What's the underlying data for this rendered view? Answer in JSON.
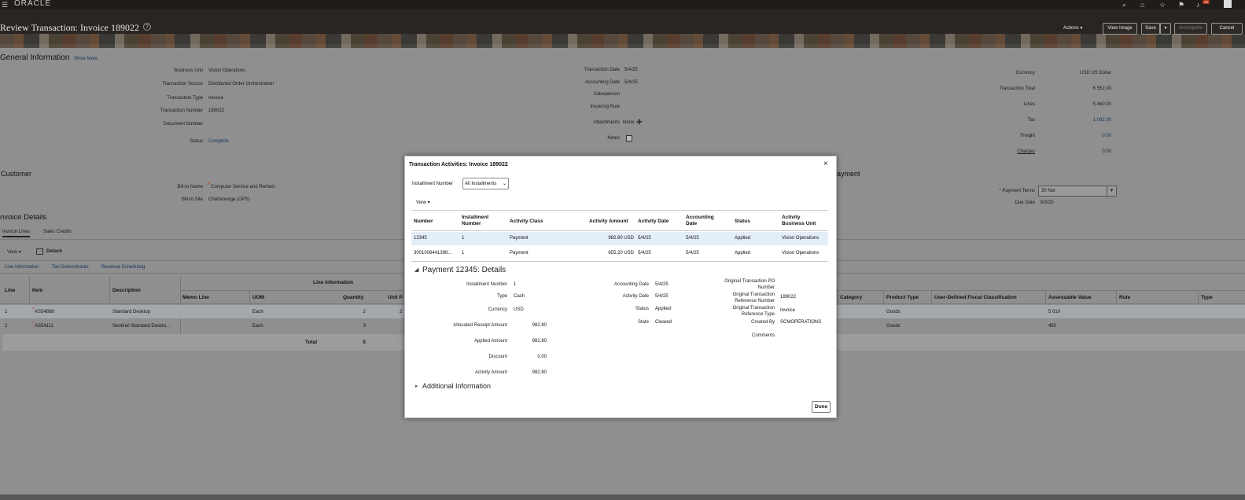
{
  "header": {
    "logo": "ORACLE",
    "title": "Review Transaction: Invoice 189022",
    "actions": "Actions",
    "view_image": "View Image",
    "save": "Save",
    "incomplete": "Incomplete",
    "cancel": "Cancel",
    "notif_count": "99"
  },
  "general": {
    "heading": "General Information",
    "show_more": "Show More",
    "left": [
      {
        "l": "Business Unit",
        "v": "Vision Operations"
      },
      {
        "l": "Transaction Source",
        "v": "Distributed Order Orchestration"
      },
      {
        "l": "Transaction Type",
        "v": "Invoice"
      },
      {
        "l": "Transaction Number",
        "v": "189022"
      },
      {
        "l": "Document Number",
        "v": ""
      },
      {
        "l": "Status",
        "v": "Complete"
      }
    ],
    "mid": [
      {
        "l": "Transaction Date",
        "v": "5/4/25"
      },
      {
        "l": "Accounting Date",
        "v": "5/4/25"
      },
      {
        "l": "Salesperson",
        "v": ""
      },
      {
        "l": "Invoicing Rule",
        "v": ""
      },
      {
        "l": "Attachments",
        "v": "None"
      },
      {
        "l": "Notes",
        "v": ""
      }
    ],
    "right": [
      {
        "l": "Currency",
        "v": "USD US Dollar"
      },
      {
        "l": "Transaction Total",
        "v": "6 552.00"
      },
      {
        "l": "Lines",
        "v": "5 460.00"
      },
      {
        "l": "Tax",
        "v": "1 092.00"
      },
      {
        "l": "Freight",
        "v": "0.00"
      },
      {
        "l": "Charges",
        "v": "0.00"
      }
    ]
  },
  "customer": {
    "heading": "Customer",
    "bill_to_name_label": "Bill-to Name",
    "bill_to_name": "Computer Service and Rentals",
    "bill_to_site_label": "Bill-to Site",
    "bill_to_site": "Chattanooga (OPS)"
  },
  "payment": {
    "heading": "ayment",
    "terms_label": "Payment Terms",
    "terms": "30 Net",
    "due_label": "Due Date",
    "due": "6/3/25"
  },
  "invoice_details": {
    "heading": "nvoice Details",
    "tab_lines": "Invoice Lines",
    "tab_credits": "Sales Credits",
    "view": "View",
    "detach": "Detach",
    "sub_line": "Line Information",
    "sub_tax": "Tax Determinants",
    "sub_rev": "Revenue Scheduling",
    "group_header": "Line Information",
    "cols": {
      "line": "Line",
      "item": "Item",
      "desc": "Description",
      "memo": "Memo Line",
      "uom": "UOM",
      "qty": "Quantity",
      "unit": "Unit P",
      "category": "Category",
      "ptype": "Product Type",
      "udfc": "User-Defined Fiscal Classification",
      "assess": "Assessable Value",
      "rule": "Rule",
      "type": "Type"
    },
    "rows": [
      {
        "line": "1",
        "item": "AS54888",
        "desc": "Standard Desktop",
        "uom": "Each",
        "qty": "2",
        "unit": "2",
        "ptype": "Goods",
        "assess": "5 010"
      },
      {
        "line": "2",
        "item": "AS54111",
        "desc": "Sentinel Standard Deskto...",
        "uom": "Each",
        "qty": "3",
        "unit": "",
        "ptype": "Goods",
        "assess": "450"
      }
    ],
    "total_label": "Total",
    "total_qty": "5"
  },
  "modal": {
    "title": "Transaction Activities: Invoice 189022",
    "inst_label": "Installment Number",
    "inst_value": "All Installments",
    "view": "View",
    "cols": {
      "number": "Number",
      "inst1": "Installment",
      "inst2": "Number",
      "aclass": "Activity Class",
      "amount": "Activity Amount",
      "adate": "Activity Date",
      "acc1": "Accounting",
      "acc2": "Date",
      "status": "Status",
      "bu1": "Activity",
      "bu2": "Business Unit"
    },
    "rows": [
      {
        "number": "12345",
        "inst": "1",
        "aclass": "Payment",
        "amount": "982.80 USD",
        "adate": "5/4/25",
        "accdate": "5/4/25",
        "status": "Applied",
        "bu": "Vision Operations"
      },
      {
        "number": "3001006441398...",
        "inst": "1",
        "aclass": "Payment",
        "amount": "655.20 USD",
        "adate": "5/4/25",
        "accdate": "5/4/25",
        "status": "Applied",
        "bu": "Vision Operations"
      }
    ],
    "details_title": "Payment 12345: Details",
    "d_left": [
      {
        "l": "Installment Number",
        "v": "1"
      },
      {
        "l": "Type",
        "v": "Cash"
      },
      {
        "l": "Currency",
        "v": "USD"
      },
      {
        "l": "Allocated Receipt Amount",
        "v": "982.80"
      },
      {
        "l": "Applied Amount",
        "v": "982.80"
      },
      {
        "l": "Discount",
        "v": "0.00"
      },
      {
        "l": "Activity Amount",
        "v": "982.80"
      }
    ],
    "d_mid": [
      {
        "l": "Accounting Date",
        "v": "5/4/25"
      },
      {
        "l": "Activity Date",
        "v": "5/4/25"
      },
      {
        "l": "Status",
        "v": "Applied"
      },
      {
        "l": "State",
        "v": "Cleared"
      }
    ],
    "d_right": [
      {
        "l1": "Original Transaction PO",
        "l2": "Number",
        "v": ""
      },
      {
        "l1": "Original Transaction",
        "l2": "Reference Number",
        "v": "189022"
      },
      {
        "l1": "Original Transaction",
        "l2": "Reference Type",
        "v": "Invoice"
      },
      {
        "l1": "Created By",
        "l2": "",
        "v": "SCMOPERATIONS"
      },
      {
        "l1": "Comments",
        "l2": "",
        "v": ""
      }
    ],
    "additional": "Additional Information",
    "done": "Done"
  }
}
